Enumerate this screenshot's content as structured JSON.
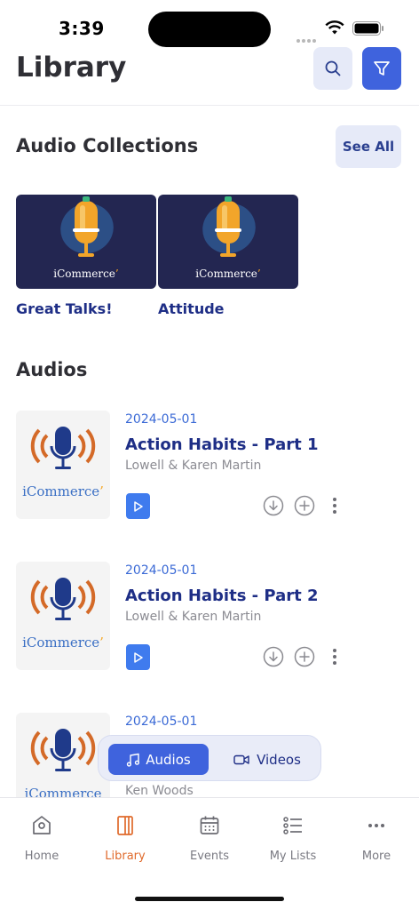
{
  "status": {
    "time": "3:39"
  },
  "header": {
    "title": "Library"
  },
  "collections": {
    "title": "Audio Collections",
    "see_all": "See All",
    "items": [
      {
        "title": "Great Talks!",
        "brand": "iCommerce"
      },
      {
        "title": "Attitude",
        "brand": "iCommerce"
      }
    ]
  },
  "audios": {
    "title": "Audios",
    "items": [
      {
        "date": "2024-05-01",
        "title": "Action Habits - Part 1",
        "author": "Lowell & Karen Martin",
        "brand": "iCommerce"
      },
      {
        "date": "2024-05-01",
        "title": "Action Habits - Part 2",
        "author": "Lowell & Karen Martin",
        "brand": "iCommerce"
      },
      {
        "date": "2024-05-01",
        "title": "",
        "author": "Ken Woods",
        "brand": "iCommerce"
      }
    ]
  },
  "media_toggle": {
    "audios": "Audios",
    "videos": "Videos",
    "selected": "Audios"
  },
  "tabs": [
    {
      "label": "Home",
      "icon": "home-icon"
    },
    {
      "label": "Library",
      "icon": "library-icon",
      "active": true
    },
    {
      "label": "Events",
      "icon": "calendar-icon"
    },
    {
      "label": "My Lists",
      "icon": "list-icon"
    },
    {
      "label": "More",
      "icon": "more-icon"
    }
  ],
  "colors": {
    "primary": "#3f63dd",
    "navy": "#1e2e86",
    "accent": "#e06a2b"
  }
}
